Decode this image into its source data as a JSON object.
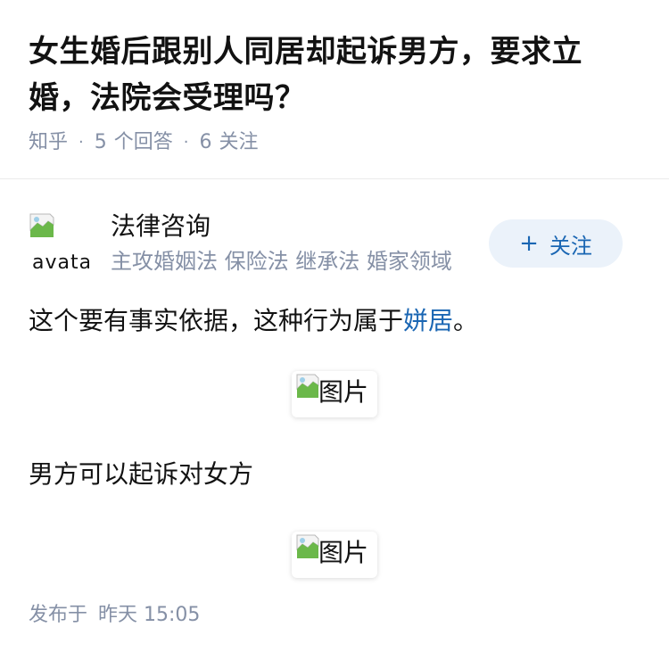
{
  "question": {
    "title": "女生婚后跟别人同居却起诉男方，要求立婚，法院会受理吗？",
    "source": "知乎",
    "answer_count": "5",
    "answer_label": "个回答",
    "follower_count": "6",
    "follower_label": "关注"
  },
  "author": {
    "avatar_alt": "avatar",
    "name": "法律咨询",
    "bio": "主攻婚姻法 保险法 继承法 婚家领域",
    "follow_icon": "+",
    "follow_label": "关注"
  },
  "answer": {
    "paragraph1_text": "这个要有事实依据，这种行为属于",
    "paragraph1_link": "姘居",
    "paragraph1_end": "。",
    "image1_alt": "图片",
    "paragraph2": "男方可以起诉对女方",
    "image2_alt": "图片"
  },
  "footer": {
    "published_label": "发布于",
    "published_time": "昨天 15:05"
  },
  "colors": {
    "title": "#121212",
    "meta": "#8590a6",
    "link": "#1a66b3",
    "follow_bg": "#ebf2fa"
  }
}
